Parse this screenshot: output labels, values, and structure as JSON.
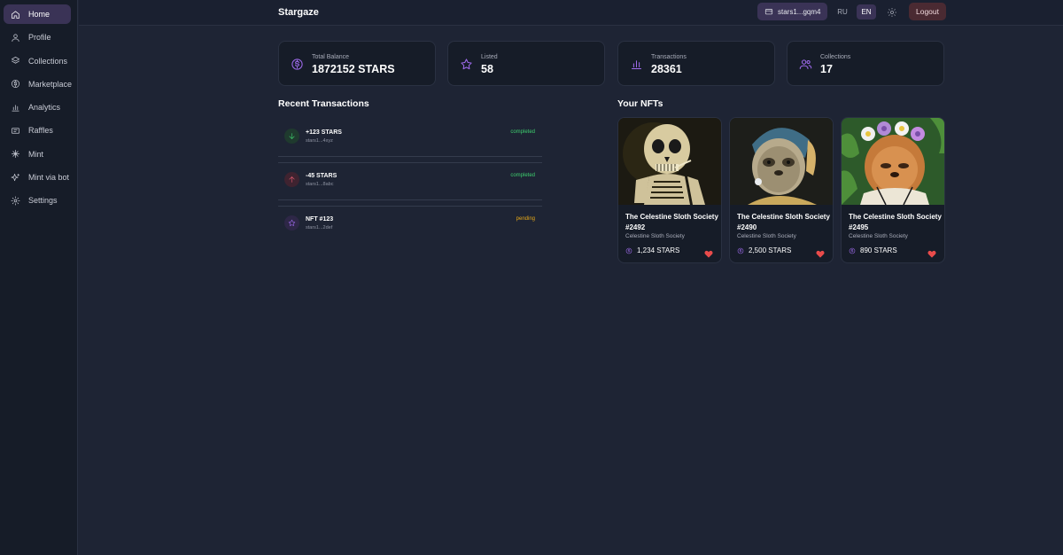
{
  "sidebar": {
    "items": [
      {
        "label": "Home",
        "icon": "home-icon",
        "active": true
      },
      {
        "label": "Profile",
        "icon": "user-icon"
      },
      {
        "label": "Collections",
        "icon": "layers-icon"
      },
      {
        "label": "Marketplace",
        "icon": "dollar-icon"
      },
      {
        "label": "Analytics",
        "icon": "bar-chart-icon"
      },
      {
        "label": "Raffles",
        "icon": "ticket-icon"
      },
      {
        "label": "Mint",
        "icon": "sparkle-icon"
      },
      {
        "label": "Mint via bot",
        "icon": "sparkles-icon"
      },
      {
        "label": "Settings",
        "icon": "gear-icon"
      }
    ]
  },
  "header": {
    "brand": "Stargaze",
    "wallet": "stars1...gqm4",
    "lang_ru": "RU",
    "lang_en": "EN",
    "logout": "Logout"
  },
  "stats": [
    {
      "label": "Total Balance",
      "value": "1872152 STARS",
      "icon": "dollar-circle-icon"
    },
    {
      "label": "Listed",
      "value": "58",
      "icon": "star-icon"
    },
    {
      "label": "Transactions",
      "value": "28361",
      "icon": "bar-chart-icon"
    },
    {
      "label": "Collections",
      "value": "17",
      "icon": "users-icon"
    }
  ],
  "recent_transactions": {
    "title": "Recent Transactions",
    "items": [
      {
        "name": "+123 STARS",
        "address": "stars1...4xyz",
        "status": "completed",
        "icon": "arrow-down-icon"
      },
      {
        "name": "-45 STARS",
        "address": "stars1...8abc",
        "status": "completed",
        "icon": "arrow-up-icon"
      },
      {
        "name": "NFT #123",
        "address": "stars1...2def",
        "status": "pending",
        "icon": "star-icon"
      }
    ]
  },
  "nfts": {
    "title": "Your NFTs",
    "items": [
      {
        "title": "The Celestine Sloth Society #2492",
        "collection": "Celestine Sloth Society",
        "price": "1,234 STARS"
      },
      {
        "title": "The Celestine Sloth Society #2490",
        "collection": "Celestine Sloth Society",
        "price": "2,500 STARS"
      },
      {
        "title": "The Celestine Sloth Society #2495",
        "collection": "Celestine Sloth Society",
        "price": "890 STARS"
      }
    ]
  },
  "colors": {
    "accent": "#a16cf0",
    "completed": "#3ecf6e",
    "pending": "#e6a817",
    "heart": "#e94b4b"
  }
}
